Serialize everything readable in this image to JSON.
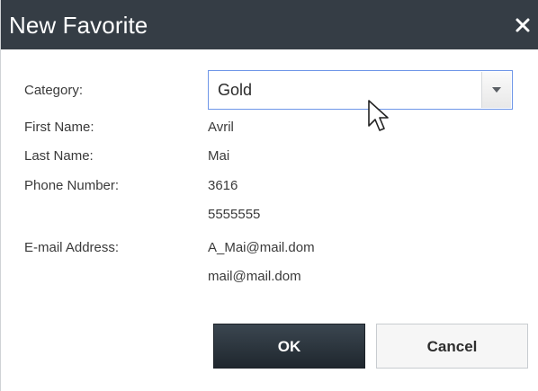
{
  "dialog": {
    "title": "New Favorite",
    "close_icon": "close-icon"
  },
  "form": {
    "category_label": "Category:",
    "category_value": "Gold",
    "first_name_label": "First Name:",
    "first_name_value": "Avril",
    "last_name_label": "Last Name:",
    "last_name_value": "Mai",
    "phone_label": "Phone Number:",
    "phone_values": [
      "3616",
      "5555555"
    ],
    "email_label": "E-mail Address:",
    "email_values": [
      "A_Mai@mail.dom",
      "mail@mail.dom"
    ]
  },
  "buttons": {
    "ok_label": "OK",
    "cancel_label": "Cancel"
  },
  "colors": {
    "title_bar": "#353d45",
    "select_border": "#6e96e8",
    "ok_button": "#2b343c"
  }
}
